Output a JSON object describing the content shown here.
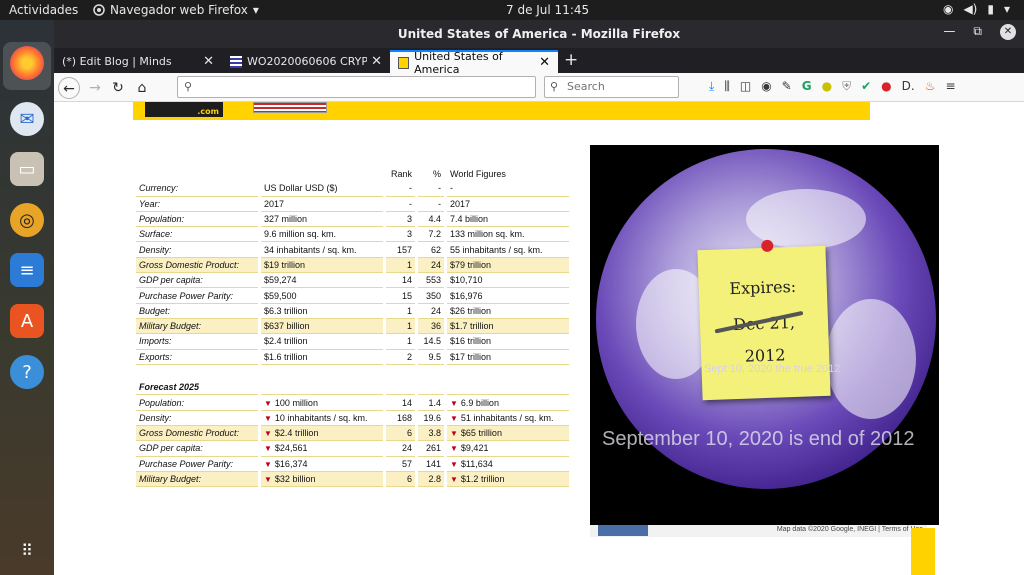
{
  "topbar": {
    "activities": "Actividades",
    "app": "Navegador web Firefox",
    "clock": "7 de Jul  11:45"
  },
  "window": {
    "title": "United States of America - Mozilla Firefox"
  },
  "tabs": [
    {
      "label": "(*) Edit Blog | Minds"
    },
    {
      "label": "WO2020060606 CRYPTOC"
    },
    {
      "label": "United States of America"
    }
  ],
  "navbar": {
    "search_placeholder": "Search"
  },
  "table": {
    "headers": {
      "rank": "Rank",
      "pct": "%",
      "world": "World Figures"
    },
    "rows": [
      {
        "label": "Currency:",
        "value": "US Dollar USD ($)",
        "rank": "-",
        "pct": "-",
        "world": "-",
        "hl": false
      },
      {
        "label": "Year:",
        "value": "2017",
        "rank": "-",
        "pct": "-",
        "world": "2017",
        "hl": false
      },
      {
        "label": "Population:",
        "value": "327 million",
        "rank": "3",
        "pct": "4.4",
        "world": "7.4 billion",
        "hl": false
      },
      {
        "label": "Surface:",
        "value": "9.6 million sq. km.",
        "rank": "3",
        "pct": "7.2",
        "world": "133 million sq. km.",
        "hl": false
      },
      {
        "label": "Density:",
        "value": "34 inhabitants / sq. km.",
        "rank": "157",
        "pct": "62",
        "world": "55 inhabitants / sq. km.",
        "hl": false
      },
      {
        "label": "Gross Domestic Product:",
        "value": "$19 trillion",
        "rank": "1",
        "pct": "24",
        "world": "$79 trillion",
        "hl": true
      },
      {
        "label": "GDP per capita:",
        "value": "$59,274",
        "rank": "14",
        "pct": "553",
        "world": "$10,710",
        "hl": false
      },
      {
        "label": "Purchase Power Parity:",
        "value": "$59,500",
        "rank": "15",
        "pct": "350",
        "world": "$16,976",
        "hl": false
      },
      {
        "label": "Budget:",
        "value": "$6.3 trillion",
        "rank": "1",
        "pct": "24",
        "world": "$26 trillion",
        "hl": false
      },
      {
        "label": "Military Budget:",
        "value": "$637 billion",
        "rank": "1",
        "pct": "36",
        "world": "$1.7 trillion",
        "hl": true
      },
      {
        "label": "Imports:",
        "value": "$2.4 trillion",
        "rank": "1",
        "pct": "14.5",
        "world": "$16 trillion",
        "hl": false
      },
      {
        "label": "Exports:",
        "value": "$1.6 trillion",
        "rank": "2",
        "pct": "9.5",
        "world": "$17 trillion",
        "hl": false
      }
    ],
    "forecast_title": "Forecast 2025",
    "forecast": [
      {
        "label": "Population:",
        "value": "100 million",
        "rank": "14",
        "pct": "1.4",
        "world": "6.9 billion",
        "hl": false
      },
      {
        "label": "Density:",
        "value": "10 inhabitants / sq. km.",
        "rank": "168",
        "pct": "19.6",
        "world": "51 inhabitants / sq. km.",
        "hl": false
      },
      {
        "label": "Gross Domestic Product:",
        "value": "$2.4 trillion",
        "rank": "6",
        "pct": "3.8",
        "world": "$65 trillion",
        "hl": true
      },
      {
        "label": "GDP per capita:",
        "value": "$24,561",
        "rank": "24",
        "pct": "261",
        "world": "$9,421",
        "hl": false
      },
      {
        "label": "Purchase Power Parity:",
        "value": "$16,374",
        "rank": "57",
        "pct": "141",
        "world": "$11,634",
        "hl": false
      },
      {
        "label": "Military Budget:",
        "value": "$32 billion",
        "rank": "6",
        "pct": "2.8",
        "world": "$1.2 trillion",
        "hl": true
      }
    ]
  },
  "map": {
    "note_line1": "Expires:",
    "note_line2": "Dec 21,",
    "note_line3": "2012",
    "overlay_small": "Sept 10, 2020 the true 2012",
    "overlay_large": "September 10, 2020 is end of 2012",
    "footer": "Map data ©2020 Google, INEGI  |  Terms of Use"
  }
}
